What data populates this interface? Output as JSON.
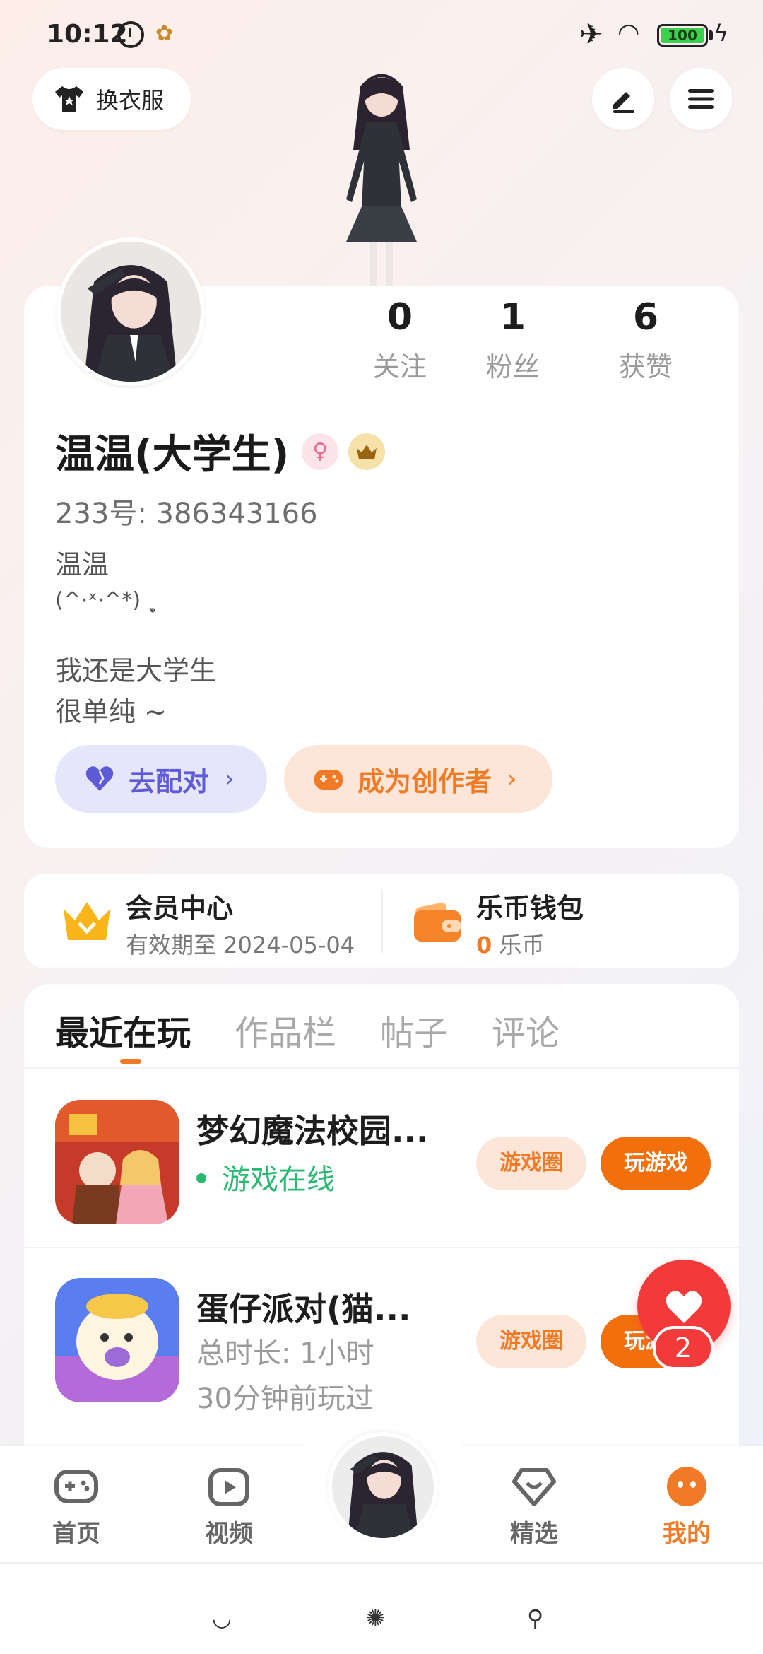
{
  "status_bar": {
    "time": "10:12",
    "battery": "100",
    "battery_level_percent": 100,
    "battery_color": "#3bd14f"
  },
  "top": {
    "outfit_label": "换衣服",
    "icons": [
      "shirt-icon",
      "edit-icon",
      "menu-icon"
    ]
  },
  "profile": {
    "stats": [
      {
        "value": "0",
        "label": "关注"
      },
      {
        "value": "1",
        "label": "粉丝"
      },
      {
        "value": "6",
        "label": "获赞"
      }
    ],
    "name": "温温(大学生)",
    "gender_symbol": "♀",
    "id_text": "233号: 386343166",
    "bio": [
      "温温",
      "(^·ˣ·^*) ˎ̥",
      "我还是大学生",
      "很单纯 ~"
    ],
    "pair_button": "去配对",
    "creator_button": "成为创作者"
  },
  "member": {
    "title": "会员中心",
    "expiry": "有效期至 2024-05-04"
  },
  "wallet": {
    "title": "乐币钱包",
    "amount": "0",
    "unit": "乐币"
  },
  "tabs": [
    "最近在玩",
    "作品栏",
    "帖子",
    "评论"
  ],
  "games": [
    {
      "title": "梦幻魔法校园...",
      "status": "游戏在线",
      "circle_label": "游戏圈",
      "play_label": "玩游戏"
    },
    {
      "title": "蛋仔派对(猫...",
      "duration": "总时长: 1小时",
      "last_played": "30分钟前玩过",
      "circle_label": "游戏圈",
      "play_label": "玩游戏"
    }
  ],
  "float": {
    "badge": "2"
  },
  "nav": [
    {
      "label": "首页",
      "icon": "gamepad-icon"
    },
    {
      "label": "视频",
      "icon": "video-icon"
    },
    {
      "label": "精选",
      "icon": "heart-gem-icon"
    },
    {
      "label": "我的",
      "icon": "face-icon"
    }
  ],
  "colors": {
    "accent": "#f07a25",
    "pair": "#5e5ad8",
    "online": "#2bb873",
    "float": "#f23a3a"
  }
}
